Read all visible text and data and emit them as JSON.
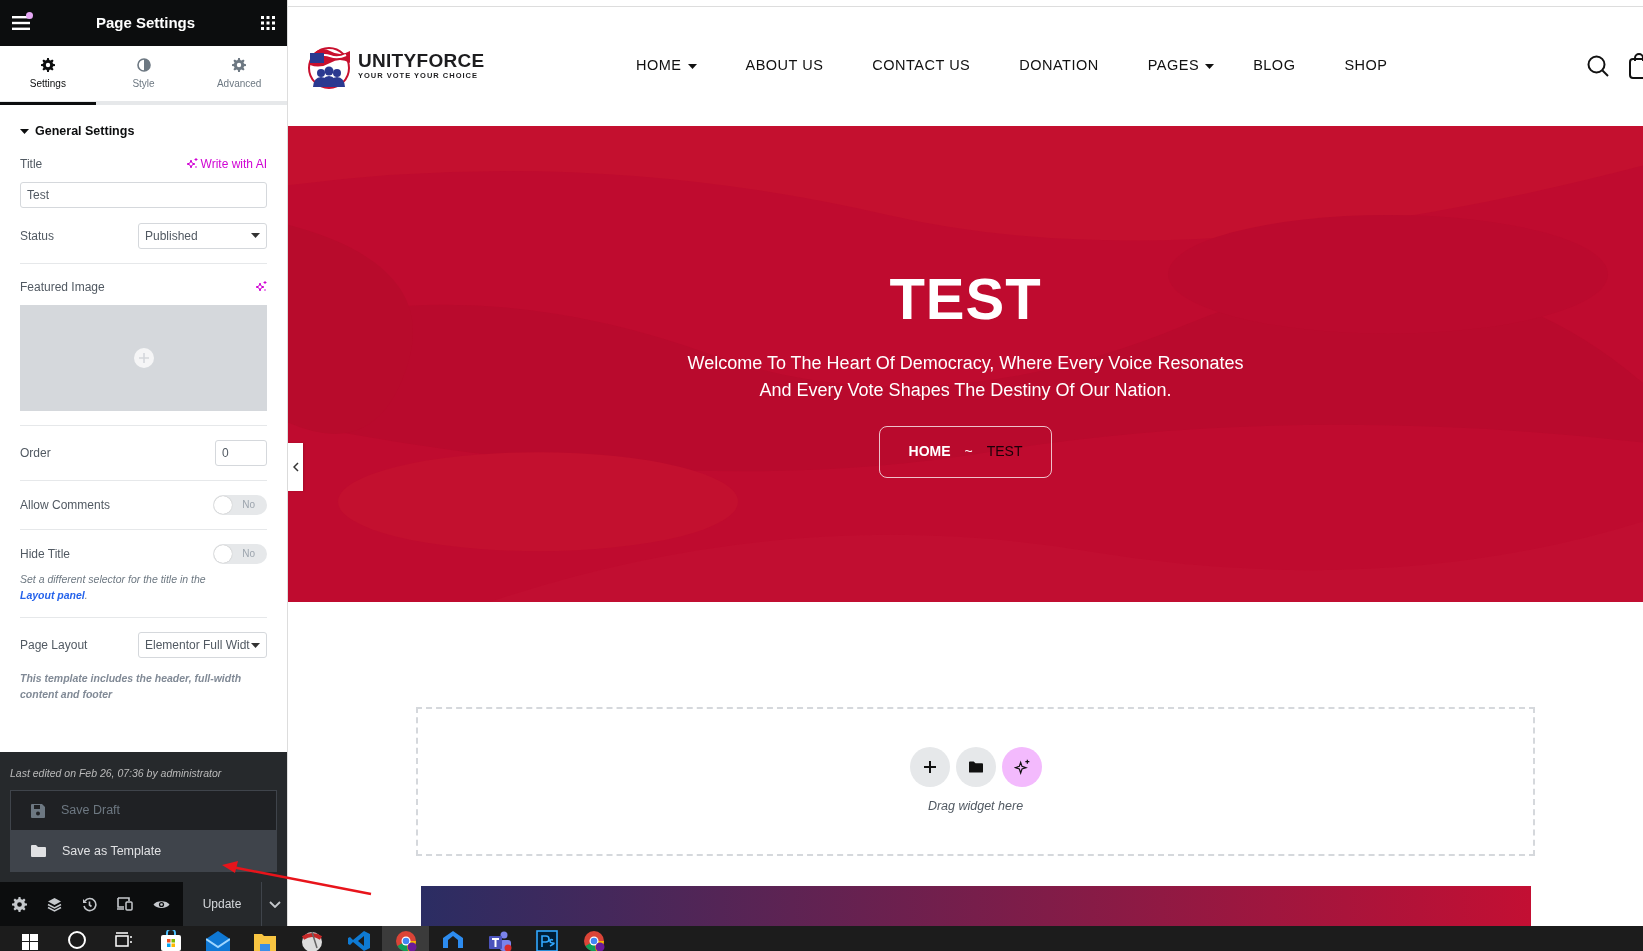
{
  "panel": {
    "title": "Page Settings",
    "notification": true,
    "tabs": [
      {
        "label": "Settings",
        "kind": "gear",
        "selected": true
      },
      {
        "label": "Style",
        "kind": "contrast",
        "selected": false
      },
      {
        "label": "Advanced",
        "kind": "gear",
        "selected": false
      }
    ],
    "section": {
      "title": "General Settings",
      "expanded": true
    },
    "fields": [
      {
        "kind": "text",
        "label": "Title",
        "value": "Test",
        "action": "Write with AI"
      },
      {
        "kind": "select",
        "label": "Status",
        "value": "Published"
      },
      {
        "label": "Featured Image"
      },
      {
        "kind": "number",
        "label": "Order",
        "value": "0"
      },
      {
        "kind": "toggle",
        "label": "Allow Comments",
        "on": false,
        "state_text": "No"
      },
      {
        "kind": "toggle",
        "label": "Hide Title",
        "on": false,
        "state_text": "No",
        "note": "Set a different selector for the title in the ",
        "note_link": "Layout panel",
        "note_end": "."
      },
      {
        "kind": "select",
        "label": "Page Layout",
        "value": "Elementor Full Widt",
        "note": "This template includes the header, full-width content and footer"
      }
    ],
    "footer": {
      "last_edited": "Last edited on Feb 26, 07:36 by administrator",
      "menu": [
        {
          "label": "Save Draft",
          "kind": "draft",
          "disabled": true
        },
        {
          "label": "Save as Template",
          "kind": "template",
          "disabled": false
        }
      ],
      "update": "Update"
    }
  },
  "site": {
    "logo_name": "UNITYFORCE",
    "tagline": "YOUR VOTE YOUR CHOICE",
    "nav": [
      {
        "label": "HOME",
        "dropdown": true
      },
      {
        "label": "ABOUT US",
        "dropdown": false
      },
      {
        "label": "CONTACT US",
        "dropdown": false
      },
      {
        "label": "DONATION",
        "dropdown": false
      },
      {
        "label": "PAGES",
        "dropdown": true
      },
      {
        "label": "BLOG",
        "dropdown": false
      },
      {
        "label": "SHOP",
        "dropdown": false
      }
    ],
    "hero": {
      "title": "TEST",
      "subtitle": "Welcome To The Heart Of Democracy, Where Every Voice Resonates And Every Vote Shapes The Destiny Of Our Nation.",
      "crumbs": [
        "HOME",
        "TEST"
      ],
      "separator": "~"
    },
    "dropzone": {
      "hint": "Drag widget here"
    }
  },
  "taskbar": [
    {
      "kind": "start",
      "selected": false
    },
    {
      "kind": "search",
      "selected": false
    },
    {
      "kind": "taskview",
      "selected": false
    },
    {
      "kind": "store",
      "selected": false
    },
    {
      "kind": "mail",
      "selected": false
    },
    {
      "kind": "folder",
      "selected": false
    },
    {
      "kind": "globe",
      "selected": false
    },
    {
      "kind": "code",
      "selected": false
    },
    {
      "kind": "chrome",
      "selected": true
    },
    {
      "kind": "cloud",
      "selected": false
    },
    {
      "kind": "teams",
      "selected": false
    },
    {
      "kind": "ps",
      "selected": false
    },
    {
      "kind": "chrome",
      "selected": false
    }
  ]
}
